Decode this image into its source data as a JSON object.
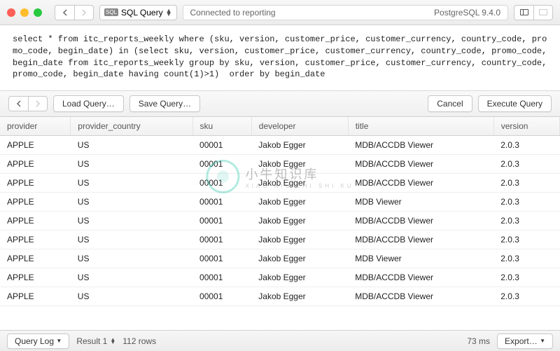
{
  "titlebar": {
    "doc_label": "SQL Query",
    "status_left": "Connected to reporting",
    "status_right": "PostgreSQL 9.4.0"
  },
  "editor": {
    "sql": "select * from itc_reports_weekly where (sku, version, customer_price, customer_currency, country_code, promo_code, begin_date) in (select sku, version, customer_price, customer_currency, country_code, promo_code, begin_date from itc_reports_weekly group by sku, version, customer_price, customer_currency, country_code, promo_code, begin_date having count(1)>1)  order by begin_date"
  },
  "toolbar": {
    "load": "Load Query…",
    "save": "Save Query…",
    "cancel": "Cancel",
    "execute": "Execute Query"
  },
  "columns": [
    "provider",
    "provider_country",
    "sku",
    "developer",
    "title",
    "version"
  ],
  "rows": [
    {
      "provider": "APPLE",
      "provider_country": "US",
      "sku": "00001",
      "developer": "Jakob Egger",
      "title": "MDB/ACCDB Viewer",
      "version": "2.0.3"
    },
    {
      "provider": "APPLE",
      "provider_country": "US",
      "sku": "00001",
      "developer": "Jakob Egger",
      "title": "MDB/ACCDB Viewer",
      "version": "2.0.3"
    },
    {
      "provider": "APPLE",
      "provider_country": "US",
      "sku": "00001",
      "developer": "Jakob Egger",
      "title": "MDB/ACCDB Viewer",
      "version": "2.0.3"
    },
    {
      "provider": "APPLE",
      "provider_country": "US",
      "sku": "00001",
      "developer": "Jakob Egger",
      "title": "MDB Viewer",
      "version": "2.0.3"
    },
    {
      "provider": "APPLE",
      "provider_country": "US",
      "sku": "00001",
      "developer": "Jakob Egger",
      "title": "MDB/ACCDB Viewer",
      "version": "2.0.3"
    },
    {
      "provider": "APPLE",
      "provider_country": "US",
      "sku": "00001",
      "developer": "Jakob Egger",
      "title": "MDB/ACCDB Viewer",
      "version": "2.0.3"
    },
    {
      "provider": "APPLE",
      "provider_country": "US",
      "sku": "00001",
      "developer": "Jakob Egger",
      "title": "MDB Viewer",
      "version": "2.0.3"
    },
    {
      "provider": "APPLE",
      "provider_country": "US",
      "sku": "00001",
      "developer": "Jakob Egger",
      "title": "MDB/ACCDB Viewer",
      "version": "2.0.3"
    },
    {
      "provider": "APPLE",
      "provider_country": "US",
      "sku": "00001",
      "developer": "Jakob Egger",
      "title": "MDB/ACCDB Viewer",
      "version": "2.0.3"
    }
  ],
  "footer": {
    "query_log": "Query Log",
    "result_label": "Result 1",
    "row_count": "112 rows",
    "timing": "73 ms",
    "export": "Export…"
  },
  "watermark": {
    "cn": "小牛知识库",
    "py": "XIAO NIU ZHI SHI KU"
  }
}
